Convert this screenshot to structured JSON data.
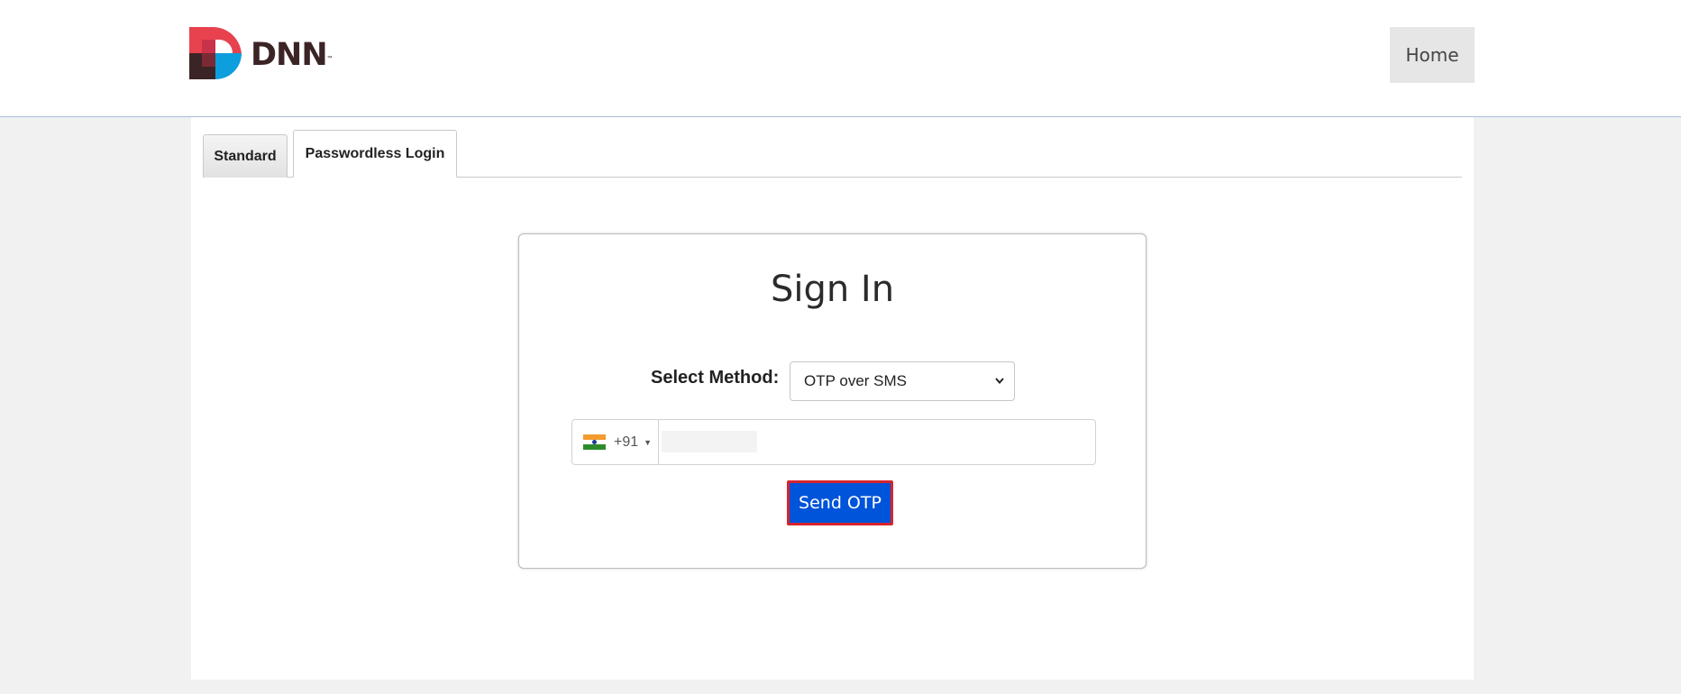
{
  "header": {
    "logo_text": "DNN",
    "logo_tm": "™",
    "home_label": "Home"
  },
  "tabs": [
    {
      "label": "Standard",
      "active": false
    },
    {
      "label": "Passwordless Login",
      "active": true
    }
  ],
  "signin": {
    "title": "Sign In",
    "method_label": "Select Method:",
    "method_selected": "OTP over SMS",
    "country_code": "+91",
    "country_flag": "india-flag",
    "phone_value": "",
    "send_label": "Send OTP"
  },
  "colors": {
    "send_button_bg": "#0054d9",
    "send_button_border": "#d6252e",
    "logo_red": "#e8424f",
    "logo_blue": "#0d9ede",
    "logo_dark": "#3b2426"
  }
}
